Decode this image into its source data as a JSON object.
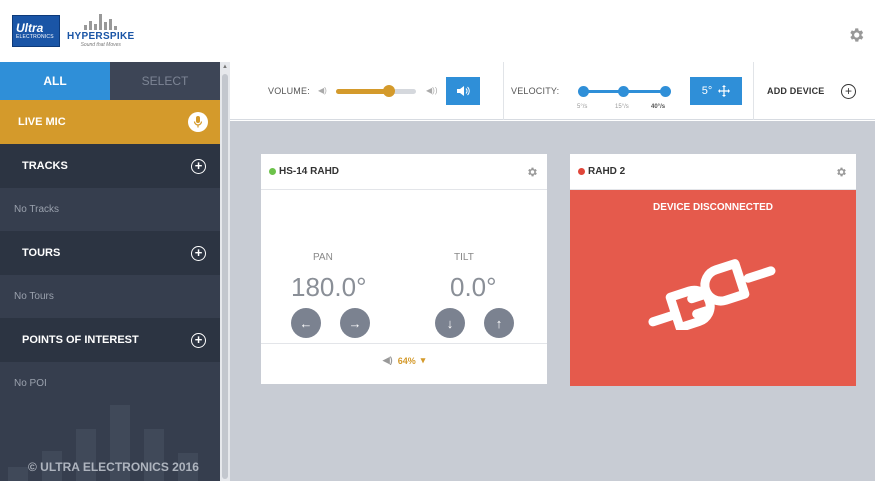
{
  "brand": {
    "ultra_line1": "Ultra",
    "ultra_line2": "ELECTRONICS",
    "product": "HYPERSPIKE",
    "tagline": "Sound that Moves"
  },
  "sidebar": {
    "tabs": [
      "ALL",
      "SELECT"
    ],
    "live_mic": "LIVE MIC",
    "sections": [
      {
        "title": "TRACKS",
        "empty": "No Tracks"
      },
      {
        "title": "TOURS",
        "empty": "No Tours"
      },
      {
        "title": "POINTS OF INTEREST",
        "empty": "No POI"
      }
    ],
    "copyright": "© ULTRA ELECTRONICS 2016"
  },
  "toolbar": {
    "volume_label": "VOLUME:",
    "volume_level": 0.66,
    "velocity_label": "VELOCITY:",
    "velocity_ticks": [
      "5°/s",
      "15°/s",
      "40°/s"
    ],
    "velocity_selected": "40°/s",
    "step_button": "5°",
    "add_device": "ADD DEVICE"
  },
  "devices": [
    {
      "name": "HS-14 RAHD",
      "status_color": "#6cc24a",
      "pan_label": "PAN",
      "pan_value": "180.0°",
      "tilt_label": "TILT",
      "tilt_value": "0.0°",
      "volume": "64%"
    },
    {
      "name": "RAHD 2",
      "status_color": "#e0463a",
      "message": "DEVICE DISCONNECTED"
    }
  ],
  "colors": {
    "accent_blue": "#2f8fd8",
    "accent_gold": "#d49a2b",
    "sidebar_bg": "#2c3442",
    "disconnected": "#e55a4c"
  }
}
